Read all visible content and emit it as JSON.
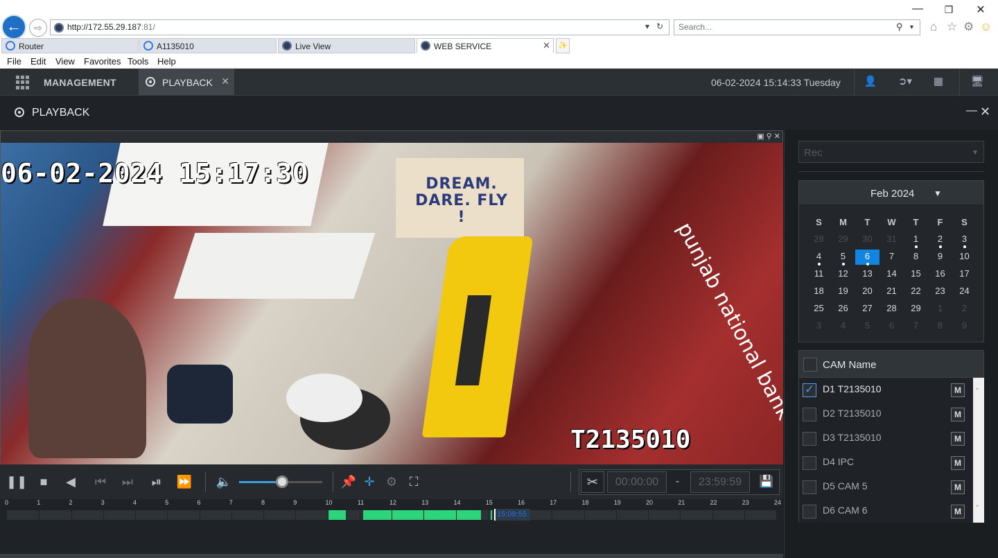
{
  "browser": {
    "url_prefix": "http://172.55.29.187",
    "url_suffix": ":81/",
    "search_placeholder": "Search...",
    "tabs": [
      {
        "label": "Router"
      },
      {
        "label": "A1135010"
      },
      {
        "label": "Live View"
      },
      {
        "label": "WEB SERVICE"
      }
    ],
    "menu": [
      "File",
      "Edit",
      "View",
      "Favorites",
      "Tools",
      "Help"
    ]
  },
  "app": {
    "management_label": "MANAGEMENT",
    "playback_tab_label": "PLAYBACK",
    "datetime": "06-02-2024 15:14:33 Tuesday",
    "panel_title": "PLAYBACK"
  },
  "video": {
    "osd_time": "06-02-2024 15:17:30",
    "osd_name": "T2135010",
    "scene_text": "DREAM. DARE. FLY !",
    "brand_text": "punjab national bank"
  },
  "controls": {
    "volume_fraction": 0.52,
    "clip_start": "00:00:00",
    "clip_separator": "-",
    "clip_end": "23:59:59"
  },
  "timeline": {
    "hour_labels": [
      "0",
      "1",
      "2",
      "3",
      "4",
      "5",
      "6",
      "7",
      "8",
      "9",
      "10",
      "11",
      "12",
      "13",
      "14",
      "15",
      "16",
      "17",
      "18",
      "19",
      "20",
      "21",
      "22",
      "23",
      "24"
    ],
    "recordings_hours": [
      [
        10.0,
        10.58
      ],
      [
        11.12,
        14.8
      ],
      [
        15.09,
        15.14
      ]
    ],
    "cursor_time": "15:09:55"
  },
  "sidebar": {
    "record_type": "Rec",
    "calendar": {
      "month_label": "Feb 2024",
      "weekdays": [
        "S",
        "M",
        "T",
        "W",
        "T",
        "F",
        "S"
      ],
      "days": [
        {
          "d": "28",
          "muted": true
        },
        {
          "d": "29",
          "muted": true
        },
        {
          "d": "30",
          "muted": true
        },
        {
          "d": "31",
          "muted": true
        },
        {
          "d": "1",
          "rec": true
        },
        {
          "d": "2",
          "rec": true
        },
        {
          "d": "3",
          "rec": true
        },
        {
          "d": "4",
          "rec": true
        },
        {
          "d": "5",
          "rec": true
        },
        {
          "d": "6",
          "sel": true,
          "rec": true
        },
        {
          "d": "7"
        },
        {
          "d": "8"
        },
        {
          "d": "9"
        },
        {
          "d": "10"
        },
        {
          "d": "11"
        },
        {
          "d": "12"
        },
        {
          "d": "13"
        },
        {
          "d": "14"
        },
        {
          "d": "15"
        },
        {
          "d": "16"
        },
        {
          "d": "17"
        },
        {
          "d": "18"
        },
        {
          "d": "19"
        },
        {
          "d": "20"
        },
        {
          "d": "21"
        },
        {
          "d": "22"
        },
        {
          "d": "23"
        },
        {
          "d": "24"
        },
        {
          "d": "25"
        },
        {
          "d": "26"
        },
        {
          "d": "27"
        },
        {
          "d": "28"
        },
        {
          "d": "29"
        },
        {
          "d": "1",
          "muted": true
        },
        {
          "d": "2",
          "muted": true
        },
        {
          "d": "3",
          "muted": true
        },
        {
          "d": "4",
          "muted": true
        },
        {
          "d": "5",
          "muted": true
        },
        {
          "d": "6",
          "muted": true
        },
        {
          "d": "7",
          "muted": true
        },
        {
          "d": "8",
          "muted": true
        },
        {
          "d": "9",
          "muted": true
        }
      ]
    },
    "cam_header": "CAM Name",
    "cameras": [
      {
        "name": "D1 T2135010",
        "checked": true,
        "m": "M"
      },
      {
        "name": "D2 T2135010",
        "checked": false,
        "m": "M"
      },
      {
        "name": "D3 T2135010",
        "checked": false,
        "m": "M"
      },
      {
        "name": "D4 IPC",
        "checked": false,
        "m": "M"
      },
      {
        "name": "D5 CAM 5",
        "checked": false,
        "m": "M"
      },
      {
        "name": "D6 CAM 6",
        "checked": false,
        "m": "M"
      }
    ]
  },
  "colors": {
    "accent": "#1185e0",
    "recording": "#2ed47a",
    "background": "#1b1e21"
  }
}
